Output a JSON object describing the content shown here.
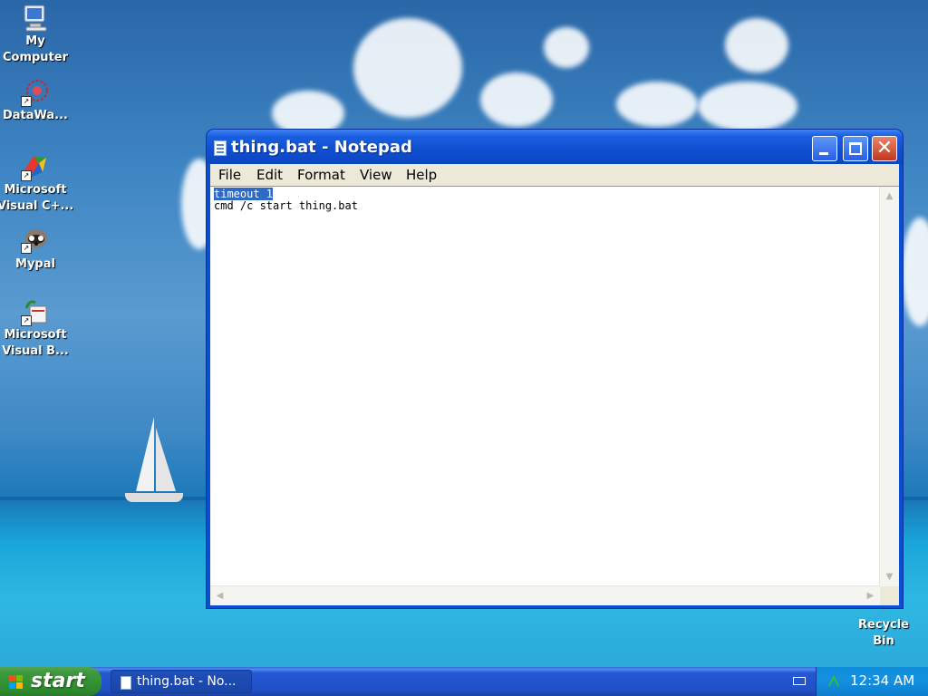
{
  "desktop": {
    "icons": [
      {
        "label_lines": [
          "My",
          "Computer"
        ],
        "icon": "my-computer-icon"
      },
      {
        "label_lines": [
          "DataWa..."
        ],
        "icon": "datawa-icon"
      },
      {
        "label_lines": [
          "Microsoft",
          "Visual C+..."
        ],
        "icon": "visual-cpp-icon"
      },
      {
        "label_lines": [
          "Mypal"
        ],
        "icon": "mypal-icon"
      },
      {
        "label_lines": [
          "Microsoft",
          "Visual B..."
        ],
        "icon": "visual-basic-icon"
      }
    ],
    "recycle_bin": {
      "label_lines": [
        "Recycle",
        "Bin"
      ],
      "icon": "recycle-bin-icon"
    }
  },
  "window": {
    "title": "thing.bat - Notepad",
    "menu": [
      "File",
      "Edit",
      "Format",
      "View",
      "Help"
    ],
    "content": {
      "selected_line": "timeout 1",
      "line2": "cmd /c start thing.bat"
    }
  },
  "taskbar": {
    "start_label": "start",
    "tasks": [
      {
        "label": "thing.bat - No..."
      }
    ],
    "clock": "12:34 AM"
  },
  "colors": {
    "titlebar": "#0f4fd0",
    "selection": "#316ac5",
    "taskbar": "#2150c6",
    "start_button": "#3c9a3c"
  }
}
